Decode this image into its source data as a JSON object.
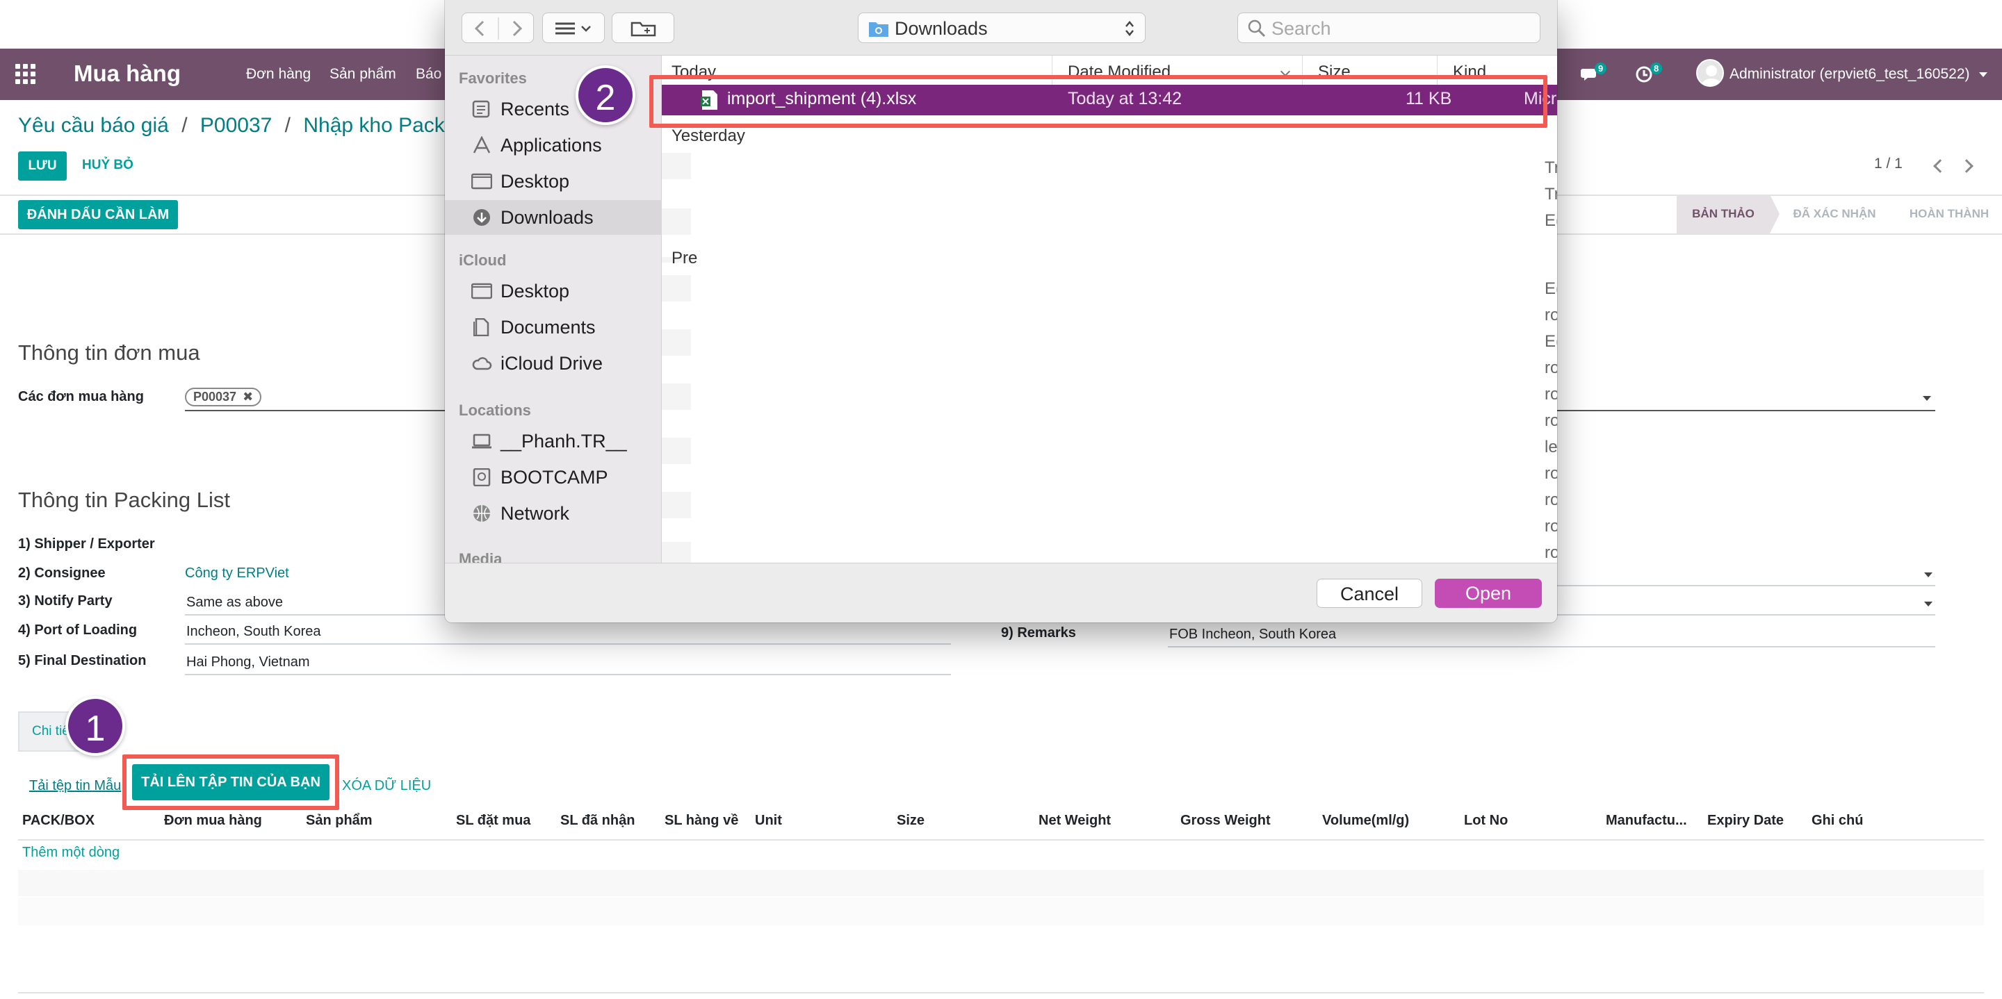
{
  "topnav": {
    "app_name": "Mua hàng",
    "menu": [
      "Đơn hàng",
      "Sản phẩm",
      "Báo"
    ],
    "chat_count": "9",
    "activity_count": "8",
    "user": "Administrator (erpviet6_test_160522)"
  },
  "breadcrumb": [
    "Yêu cầu báo giá",
    "P00037",
    "Nhập kho Packing L"
  ],
  "control": {
    "save": "LƯU",
    "discard": "HUỶ BỎ",
    "pager": "1 / 1"
  },
  "header": {
    "mark_todo": "ĐÁNH DẤU CẦN LÀM",
    "stages": [
      "BẢN THẢO",
      "ĐÃ XÁC NHẬN",
      "HOÀN THÀNH"
    ],
    "active_stage": "BẢN THẢO"
  },
  "purchase_section": {
    "title": "Thông tin đơn mua",
    "label": "Các đơn mua hàng",
    "tag": "P00037"
  },
  "packing_section": {
    "title": "Thông tin Packing List",
    "fields": [
      {
        "label": "1) Shipper / Exporter",
        "value": ""
      },
      {
        "label": "2) Consignee",
        "value": "Công ty ERPViet"
      },
      {
        "label": "3) Notify Party",
        "value": "Same as above"
      },
      {
        "label": "4) Port of Loading",
        "value": "Incheon, South Korea"
      },
      {
        "label": "5) Final Destination",
        "value": "Hai Phong, Vietnam"
      }
    ],
    "remarks_label": "9) Remarks",
    "remarks_value": "FOB Incheon, South Korea"
  },
  "details": {
    "tab_label": "Chi tiế",
    "download_template": "Tải tệp tin Mẫu",
    "upload": "TẢI LÊN TẬP TIN CỦA BẠN",
    "clear": "XÓA DỮ LIỆU",
    "columns": [
      "PACK/BOX",
      "Đơn mua hàng",
      "Sản phẩm",
      "SL đặt mua",
      "SL đã nhận",
      "SL hàng về",
      "Unit",
      "Size",
      "Net Weight",
      "Gross Weight",
      "Volume(ml/g)",
      "Lot No",
      "Manufactu...",
      "Expiry Date",
      "Ghi chú"
    ],
    "add_line": "Thêm một dòng"
  },
  "steps": [
    "1",
    "2"
  ],
  "dialog": {
    "location": "Downloads",
    "search_placeholder": "Search",
    "sidebar": {
      "favorites_header": "Favorites",
      "favorites": [
        "Recents",
        "Applications",
        "Desktop",
        "Downloads"
      ],
      "icloud_header": "iCloud",
      "icloud": [
        "Desktop",
        "Documents",
        "iCloud Drive"
      ],
      "locations_header": "Locations",
      "locations": [
        "__Phanh.TR__",
        "BOOTCAMP",
        "Network"
      ],
      "media_header": "Media"
    },
    "columns": {
      "name": "Today",
      "modified": "Date Modified",
      "size": "Size",
      "kind": "Kind"
    },
    "selected_file": {
      "name": "import_shipment (4).xlsx",
      "modified": "Today at 13:42",
      "size": "11 KB",
      "kind": "Micro"
    },
    "groups": [
      "Yesterday",
      "Pre"
    ],
    "right_cut_labels": [
      "Tr",
      "Tr",
      "E(",
      "E(",
      "ro",
      "E(",
      "ro",
      "ro",
      "ro",
      "le",
      "ro",
      "ro",
      "ro",
      "ro"
    ],
    "cancel": "Cancel",
    "open": "Open"
  },
  "colors": {
    "nav": "#71506b",
    "teal": "#00a09d",
    "select": "#7a267c",
    "highlight": "#f35b52",
    "step": "#6a2b8d",
    "open_btn": "#c34cb5"
  }
}
